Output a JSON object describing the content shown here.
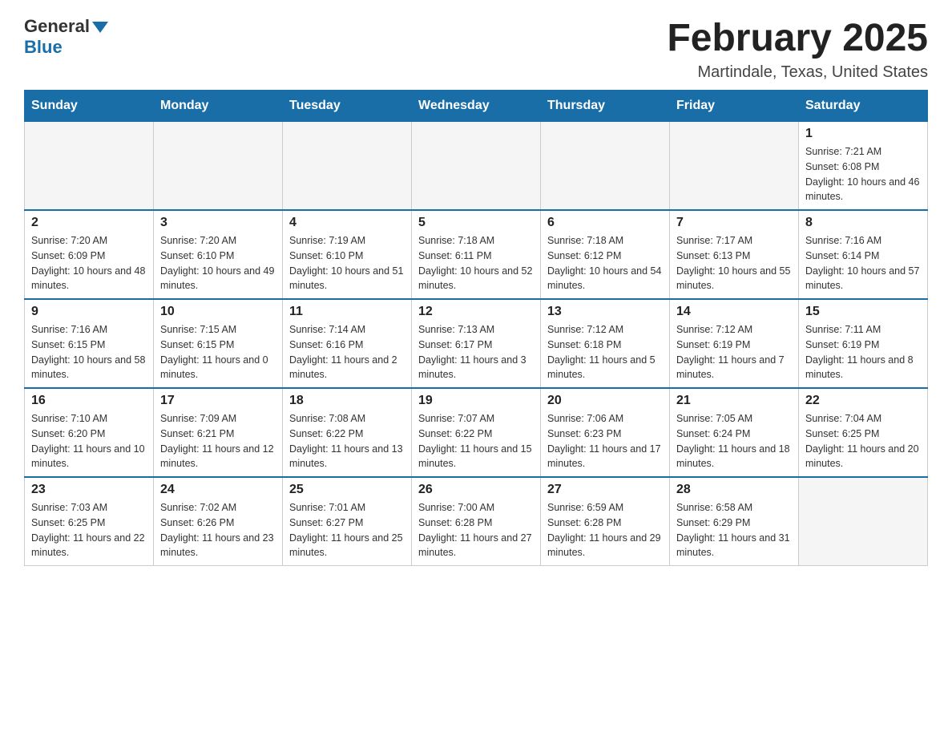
{
  "header": {
    "logo_general": "General",
    "logo_blue": "Blue",
    "month_title": "February 2025",
    "location": "Martindale, Texas, United States"
  },
  "days_of_week": [
    "Sunday",
    "Monday",
    "Tuesday",
    "Wednesday",
    "Thursday",
    "Friday",
    "Saturday"
  ],
  "weeks": [
    [
      {
        "day": "",
        "empty": true
      },
      {
        "day": "",
        "empty": true
      },
      {
        "day": "",
        "empty": true
      },
      {
        "day": "",
        "empty": true
      },
      {
        "day": "",
        "empty": true
      },
      {
        "day": "",
        "empty": true
      },
      {
        "day": "1",
        "sunrise": "7:21 AM",
        "sunset": "6:08 PM",
        "daylight": "10 hours and 46 minutes."
      }
    ],
    [
      {
        "day": "2",
        "sunrise": "7:20 AM",
        "sunset": "6:09 PM",
        "daylight": "10 hours and 48 minutes."
      },
      {
        "day": "3",
        "sunrise": "7:20 AM",
        "sunset": "6:10 PM",
        "daylight": "10 hours and 49 minutes."
      },
      {
        "day": "4",
        "sunrise": "7:19 AM",
        "sunset": "6:10 PM",
        "daylight": "10 hours and 51 minutes."
      },
      {
        "day": "5",
        "sunrise": "7:18 AM",
        "sunset": "6:11 PM",
        "daylight": "10 hours and 52 minutes."
      },
      {
        "day": "6",
        "sunrise": "7:18 AM",
        "sunset": "6:12 PM",
        "daylight": "10 hours and 54 minutes."
      },
      {
        "day": "7",
        "sunrise": "7:17 AM",
        "sunset": "6:13 PM",
        "daylight": "10 hours and 55 minutes."
      },
      {
        "day": "8",
        "sunrise": "7:16 AM",
        "sunset": "6:14 PM",
        "daylight": "10 hours and 57 minutes."
      }
    ],
    [
      {
        "day": "9",
        "sunrise": "7:16 AM",
        "sunset": "6:15 PM",
        "daylight": "10 hours and 58 minutes."
      },
      {
        "day": "10",
        "sunrise": "7:15 AM",
        "sunset": "6:15 PM",
        "daylight": "11 hours and 0 minutes."
      },
      {
        "day": "11",
        "sunrise": "7:14 AM",
        "sunset": "6:16 PM",
        "daylight": "11 hours and 2 minutes."
      },
      {
        "day": "12",
        "sunrise": "7:13 AM",
        "sunset": "6:17 PM",
        "daylight": "11 hours and 3 minutes."
      },
      {
        "day": "13",
        "sunrise": "7:12 AM",
        "sunset": "6:18 PM",
        "daylight": "11 hours and 5 minutes."
      },
      {
        "day": "14",
        "sunrise": "7:12 AM",
        "sunset": "6:19 PM",
        "daylight": "11 hours and 7 minutes."
      },
      {
        "day": "15",
        "sunrise": "7:11 AM",
        "sunset": "6:19 PM",
        "daylight": "11 hours and 8 minutes."
      }
    ],
    [
      {
        "day": "16",
        "sunrise": "7:10 AM",
        "sunset": "6:20 PM",
        "daylight": "11 hours and 10 minutes."
      },
      {
        "day": "17",
        "sunrise": "7:09 AM",
        "sunset": "6:21 PM",
        "daylight": "11 hours and 12 minutes."
      },
      {
        "day": "18",
        "sunrise": "7:08 AM",
        "sunset": "6:22 PM",
        "daylight": "11 hours and 13 minutes."
      },
      {
        "day": "19",
        "sunrise": "7:07 AM",
        "sunset": "6:22 PM",
        "daylight": "11 hours and 15 minutes."
      },
      {
        "day": "20",
        "sunrise": "7:06 AM",
        "sunset": "6:23 PM",
        "daylight": "11 hours and 17 minutes."
      },
      {
        "day": "21",
        "sunrise": "7:05 AM",
        "sunset": "6:24 PM",
        "daylight": "11 hours and 18 minutes."
      },
      {
        "day": "22",
        "sunrise": "7:04 AM",
        "sunset": "6:25 PM",
        "daylight": "11 hours and 20 minutes."
      }
    ],
    [
      {
        "day": "23",
        "sunrise": "7:03 AM",
        "sunset": "6:25 PM",
        "daylight": "11 hours and 22 minutes."
      },
      {
        "day": "24",
        "sunrise": "7:02 AM",
        "sunset": "6:26 PM",
        "daylight": "11 hours and 23 minutes."
      },
      {
        "day": "25",
        "sunrise": "7:01 AM",
        "sunset": "6:27 PM",
        "daylight": "11 hours and 25 minutes."
      },
      {
        "day": "26",
        "sunrise": "7:00 AM",
        "sunset": "6:28 PM",
        "daylight": "11 hours and 27 minutes."
      },
      {
        "day": "27",
        "sunrise": "6:59 AM",
        "sunset": "6:28 PM",
        "daylight": "11 hours and 29 minutes."
      },
      {
        "day": "28",
        "sunrise": "6:58 AM",
        "sunset": "6:29 PM",
        "daylight": "11 hours and 31 minutes."
      },
      {
        "day": "",
        "empty": true
      }
    ]
  ]
}
